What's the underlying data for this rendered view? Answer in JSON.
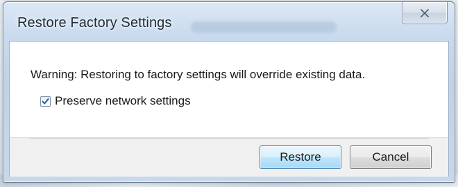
{
  "window": {
    "title": "Restore Factory Settings"
  },
  "dialog": {
    "warning": "Warning: Restoring to factory settings will override existing data.",
    "preserve_network": {
      "label": "Preserve network settings",
      "checked": true
    }
  },
  "buttons": {
    "restore_label": "Restore",
    "cancel_label": "Cancel"
  },
  "icons": {
    "close": "close-icon",
    "check": "checkmark-icon"
  },
  "colors": {
    "titlebar": "#c9dbee",
    "default_button_border": "#3c7fb1",
    "check_mark": "#2a5d9a"
  }
}
